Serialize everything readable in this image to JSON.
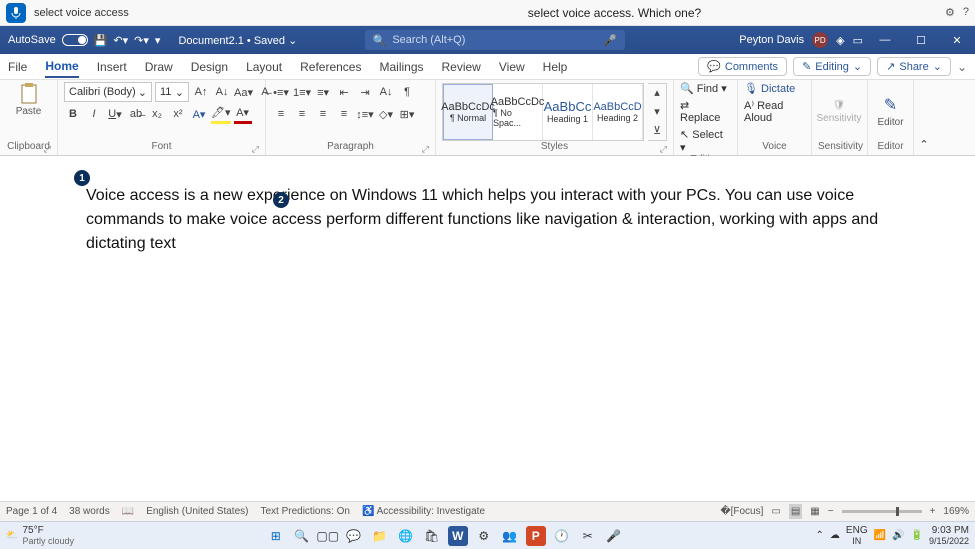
{
  "voice_access": {
    "command_text": "select voice access",
    "prompt": "select voice access. Which one?",
    "badges": [
      "1",
      "2"
    ]
  },
  "titlebar": {
    "autosave_label": "AutoSave",
    "doc_name": "Document2.1 • Saved",
    "search_placeholder": "Search (Alt+Q)",
    "user_name": "Peyton Davis",
    "user_initials": "PD"
  },
  "tabs": {
    "file": "File",
    "home": "Home",
    "insert": "Insert",
    "draw": "Draw",
    "design": "Design",
    "layout": "Layout",
    "references": "References",
    "mailings": "Mailings",
    "review": "Review",
    "view": "View",
    "help": "Help",
    "comments": "Comments",
    "editing": "Editing",
    "share": "Share"
  },
  "ribbon": {
    "clipboard": {
      "label": "Clipboard",
      "paste": "Paste"
    },
    "font": {
      "label": "Font",
      "family": "Calibri (Body)",
      "size": "11"
    },
    "paragraph": {
      "label": "Paragraph"
    },
    "styles": {
      "label": "Styles",
      "items": [
        {
          "preview": "AaBbCcDc",
          "name": "¶ Normal"
        },
        {
          "preview": "AaBbCcDc",
          "name": "¶ No Spac..."
        },
        {
          "preview": "AaBbCc",
          "name": "Heading 1"
        },
        {
          "preview": "AaBbCcD",
          "name": "Heading 2"
        }
      ]
    },
    "editing": {
      "label": "Editing",
      "find": "Find",
      "replace": "Replace",
      "select": "Select"
    },
    "voice": {
      "label": "Voice",
      "dictate": "Dictate",
      "read": "Read Aloud"
    },
    "sensitivity": {
      "label": "Sensitivity",
      "btn": "Sensitivity"
    },
    "editor": {
      "label": "Editor",
      "btn": "Editor"
    }
  },
  "document": {
    "body": "Voice access is a new experience on Windows 11 which helps you interact with your PCs. You can use voice commands to make voice access perform different functions like navigation & interaction, working with apps and dictating text"
  },
  "statusbar": {
    "page": "Page 1 of 4",
    "words": "38 words",
    "lang": "English (United States)",
    "pred": "Text Predictions: On",
    "acc": "Accessibility: Investigate",
    "focus": "Focus",
    "zoom": "169%"
  },
  "taskbar": {
    "weather_temp": "75°F",
    "weather_cond": "Partly cloudy",
    "lang": "ENG",
    "region": "IN",
    "time": "9:03 PM",
    "date": "9/15/2022"
  }
}
